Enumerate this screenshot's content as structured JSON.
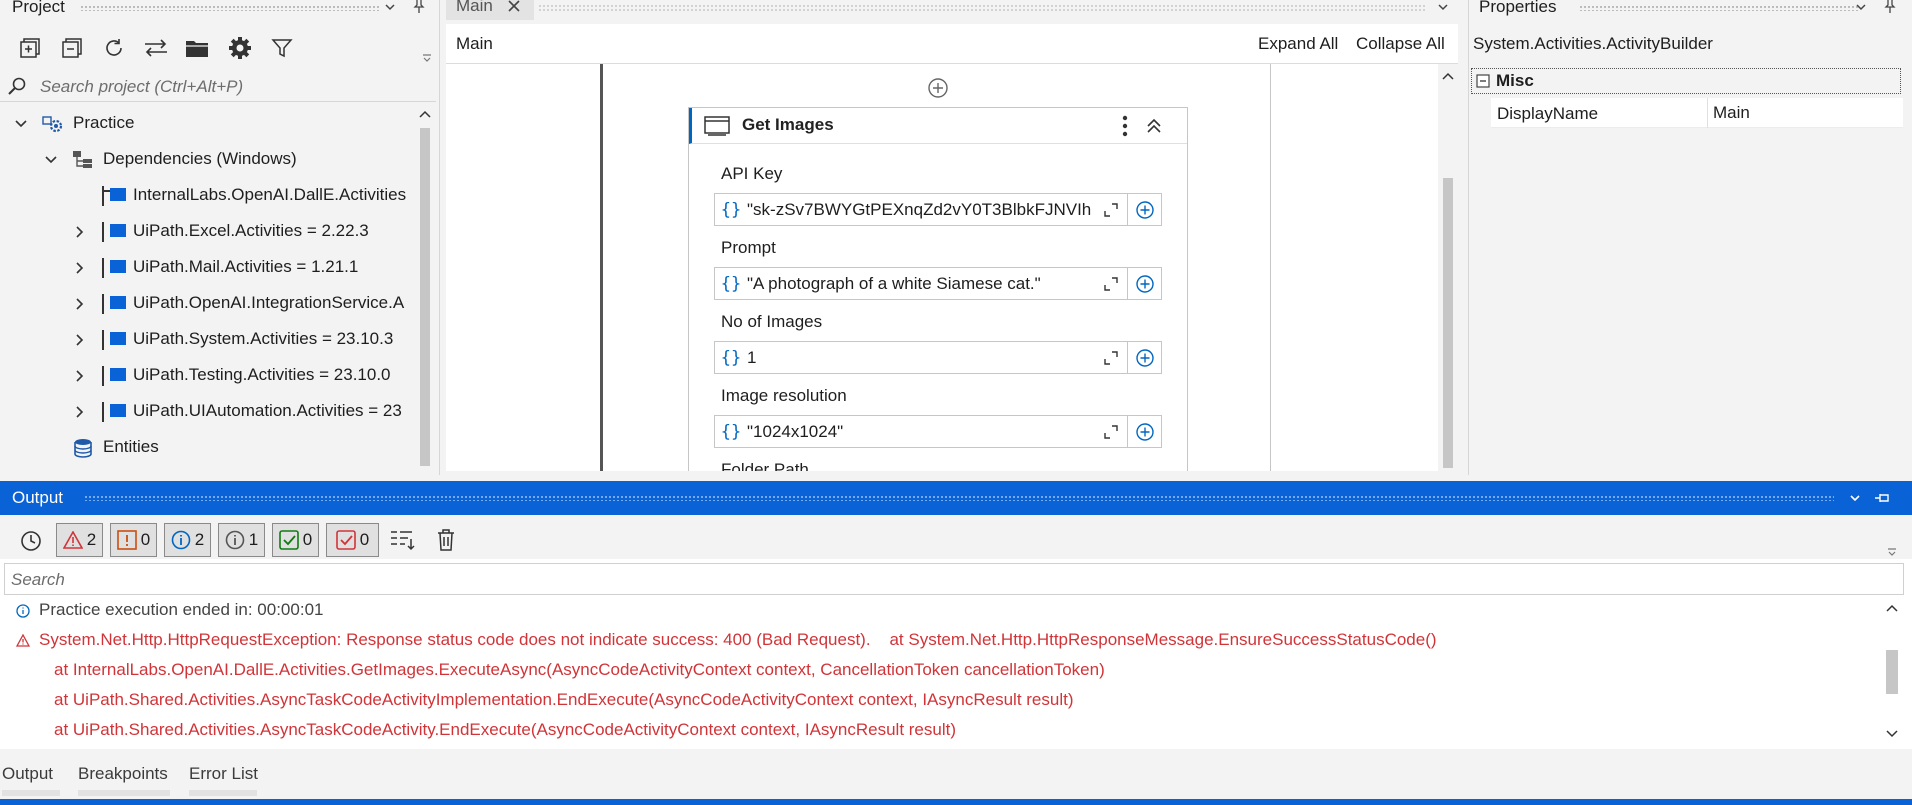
{
  "project_panel": {
    "title": "Project",
    "search_placeholder": "Search project (Ctrl+Alt+P)",
    "tree": [
      {
        "label": "Practice"
      },
      {
        "label": "Dependencies (Windows)"
      },
      {
        "label": "InternalLabs.OpenAI.DallE.Activities"
      },
      {
        "label": "UiPath.Excel.Activities = 2.22.3"
      },
      {
        "label": "UiPath.Mail.Activities = 1.21.1"
      },
      {
        "label": "UiPath.OpenAI.IntegrationService.A"
      },
      {
        "label": "UiPath.System.Activities = 23.10.3"
      },
      {
        "label": "UiPath.Testing.Activities = 23.10.0"
      },
      {
        "label": "UiPath.UIAutomation.Activities = 23"
      },
      {
        "label": "Entities"
      }
    ]
  },
  "designer": {
    "tab_label": "Main",
    "breadcrumb": "Main",
    "expand_all": "Expand All",
    "collapse_all": "Collapse All",
    "activity": {
      "title": "Get Images",
      "fields": [
        {
          "label": "API Key",
          "value": "\"sk-zSv7BWYGtPEXnqZd2vY0T3BlbkFJNVIh"
        },
        {
          "label": "Prompt",
          "value": "\"A photograph of a white Siamese cat.\""
        },
        {
          "label": "No of Images",
          "value": "1"
        },
        {
          "label": "Image resolution",
          "value": "\"1024x1024\""
        },
        {
          "label": "Folder Path",
          "value": ""
        }
      ]
    }
  },
  "properties_panel": {
    "title": "Properties",
    "object_type": "System.Activities.ActivityBuilder",
    "category": "Misc",
    "rows": [
      {
        "name": "DisplayName",
        "value": "Main"
      }
    ]
  },
  "output_panel": {
    "title": "Output",
    "search_placeholder": "Search",
    "counts": {
      "errors": "2",
      "warnings": "0",
      "info": "2",
      "trace": "1",
      "success": "0",
      "failed": "0"
    },
    "lines": [
      {
        "text": "Practice execution ended in: 00:00:01",
        "level": "info"
      },
      {
        "text": "System.Net.Http.HttpRequestException: Response status code does not indicate success: 400 (Bad Request).    at System.Net.Http.HttpResponseMessage.EnsureSuccessStatusCode()",
        "level": "error"
      },
      {
        "text": "at InternalLabs.OpenAI.DallE.Activities.GetImages.ExecuteAsync(AsyncCodeActivityContext context, CancellationToken cancellationToken)",
        "level": "error-cont"
      },
      {
        "text": "at UiPath.Shared.Activities.AsyncTaskCodeActivityImplementation.EndExecute(AsyncCodeActivityContext context, IAsyncResult result)",
        "level": "error-cont"
      },
      {
        "text": "at UiPath.Shared.Activities.AsyncTaskCodeActivity.EndExecute(AsyncCodeActivityContext context, IAsyncResult result)",
        "level": "error-cont"
      }
    ]
  },
  "bottom_tabs": [
    "Output",
    "Breakpoints",
    "Error List"
  ],
  "colors": {
    "accent": "#0067c0",
    "error": "#d13438",
    "output_header": "#0a63d6"
  }
}
